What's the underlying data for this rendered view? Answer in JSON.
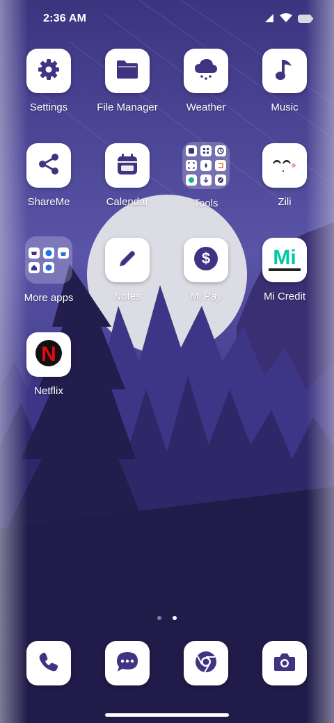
{
  "status_bar": {
    "time": "2:36 AM"
  },
  "apps": [
    {
      "label": "Settings",
      "icon": "gear-icon"
    },
    {
      "label": "File Manager",
      "icon": "folder-icon"
    },
    {
      "label": "Weather",
      "icon": "cloud-rain-icon"
    },
    {
      "label": "Music",
      "icon": "music-note-icon"
    },
    {
      "label": "ShareMe",
      "icon": "share-icon"
    },
    {
      "label": "Calendar",
      "icon": "calendar-icon"
    },
    {
      "label": "Tools",
      "icon": "tools-folder-icon"
    },
    {
      "label": "Zili",
      "icon": "zili-face-icon"
    },
    {
      "label": "More apps",
      "icon": "apps-folder-icon"
    },
    {
      "label": "Notes",
      "icon": "pencil-icon"
    },
    {
      "label": "Mi Pay",
      "icon": "dollar-coin-icon"
    },
    {
      "label": "Mi Credit",
      "icon": "mi-credit-logo",
      "logo_text": "Mi"
    },
    {
      "label": "Netflix",
      "icon": "netflix-logo",
      "logo_text": "N"
    }
  ],
  "pages": {
    "count": 2,
    "current": 2
  },
  "dock": [
    {
      "name": "phone",
      "icon": "phone-icon"
    },
    {
      "name": "messages",
      "icon": "message-bubble-icon"
    },
    {
      "name": "browser",
      "icon": "chrome-icon"
    },
    {
      "name": "camera",
      "icon": "camera-icon"
    }
  ],
  "colors": {
    "icon_purple": "#3f3482",
    "tile_white": "#ffffff",
    "netflix_red": "#e50914",
    "mi_green": "#00c8a0"
  }
}
